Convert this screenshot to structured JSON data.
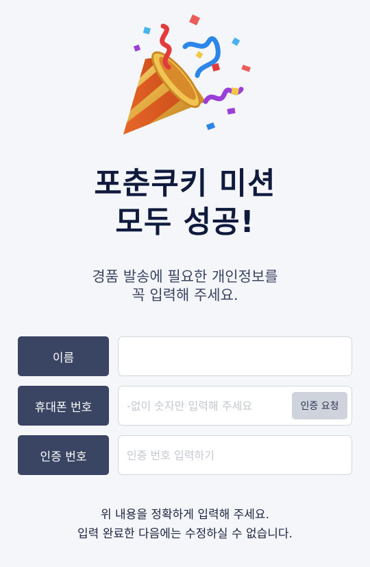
{
  "hero": {
    "icon": "party-popper-icon"
  },
  "title": {
    "line1": "포춘쿠키 미션",
    "line2": "모두 성공!"
  },
  "subtitle": {
    "line1": "경품 발송에 필요한 개인정보를",
    "line2": "꼭 입력해 주세요."
  },
  "form": {
    "name": {
      "label": "이름",
      "value": "",
      "placeholder": ""
    },
    "phone": {
      "label": "휴대폰 번호",
      "value": "",
      "placeholder": "-없이 숫자만 입력해 주세요",
      "button_label": "인증 요청"
    },
    "code": {
      "label": "인증 번호",
      "value": "",
      "placeholder": "인증 번호 입력하기"
    }
  },
  "notice": {
    "line1": "위 내용을 정확하게 입력해 주세요.",
    "line2": "입력 완료한 다음에는 수정하실 수 없습니다."
  },
  "colors": {
    "background": "#f4f6fa",
    "label_bg": "#3a4563",
    "title": "#0f1a3d",
    "button_bg": "#cfd3db"
  }
}
